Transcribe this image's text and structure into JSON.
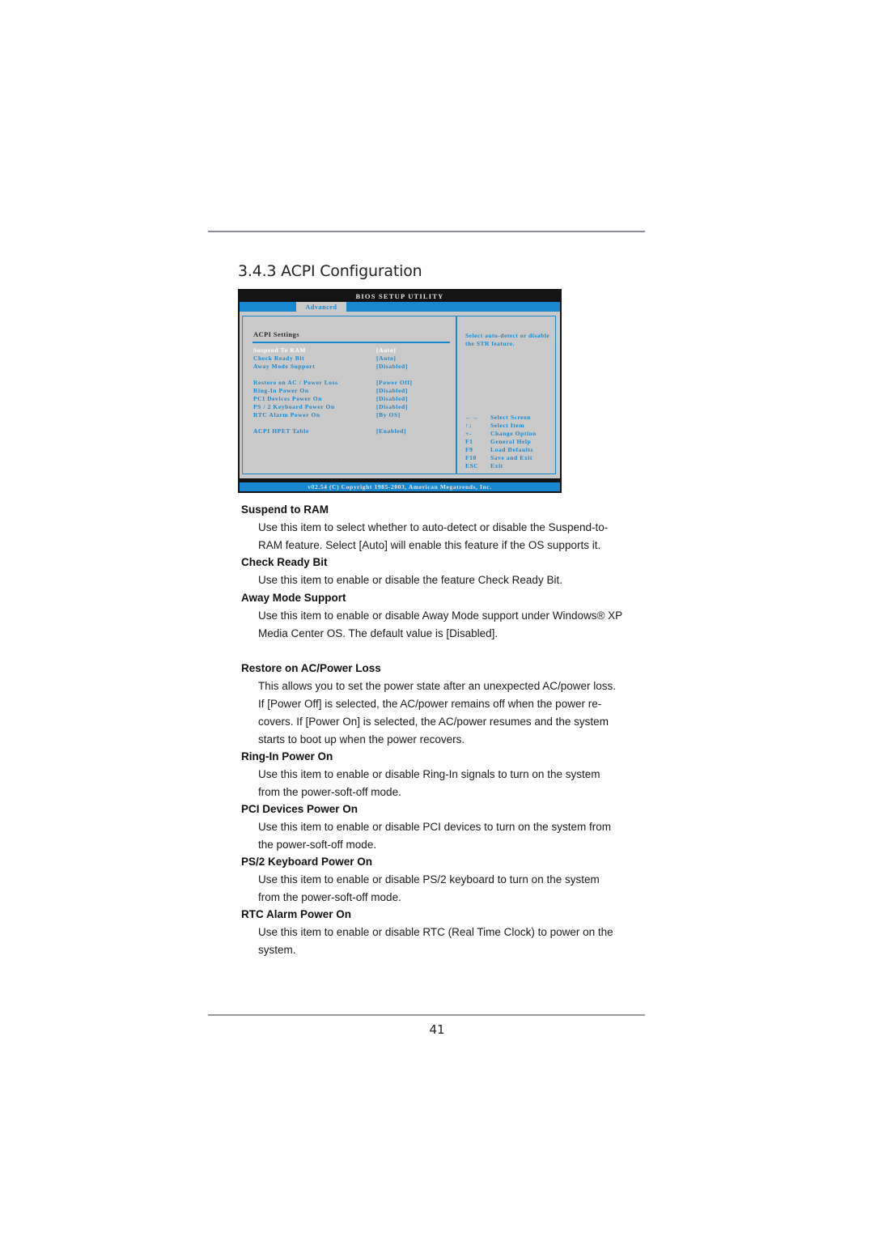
{
  "section": {
    "number": "3.4.3",
    "title": "3.4.3  ACPI Configuration"
  },
  "bios": {
    "title": "BIOS SETUP UTILITY",
    "active_tab": "Advanced",
    "heading": "ACPI Settings",
    "settings": [
      {
        "label": "Suspend To RAM",
        "value": "[Auto]",
        "selected": true
      },
      {
        "label": "Check Ready Bit",
        "value": "[Auto]",
        "selected": false
      },
      {
        "label": "Away Mode Support",
        "value": "[Disabled]",
        "selected": false
      },
      {
        "label": "Restore on AC / Power Loss",
        "value": "[Power Off]",
        "selected": false
      },
      {
        "label": "Ring-In Power On",
        "value": "[Disabled]",
        "selected": false
      },
      {
        "label": "PCI Devices Power On",
        "value": "[Disabled]",
        "selected": false
      },
      {
        "label": "PS / 2 Keyboard Power On",
        "value": "[Disabled]",
        "selected": false
      },
      {
        "label": "RTC Alarm Power On",
        "value": "[By OS]",
        "selected": false
      },
      {
        "label": "ACPI HPET Table",
        "value": "[Enabled]",
        "selected": false
      }
    ],
    "help_text": "Select auto-detect or disable the STR feature.",
    "keys": [
      {
        "key": "←→",
        "action": "Select Screen"
      },
      {
        "key": "↑↓",
        "action": "Select Item"
      },
      {
        "key": "+-",
        "action": "Change Option"
      },
      {
        "key": "F1",
        "action": "General Help"
      },
      {
        "key": "F9",
        "action": "Load Defaults"
      },
      {
        "key": "F10",
        "action": "Save and Exit"
      },
      {
        "key": "ESC",
        "action": "Exit"
      }
    ],
    "footer": "v02.54 (C) Copyright 1985-2003, American Megatrends, Inc.",
    "colors": {
      "accent": "#1787cf",
      "panel": "#c9c9c9",
      "titlebar": "#141414"
    }
  },
  "items": [
    {
      "title": "Suspend to RAM",
      "lines": [
        "Use this item to select whether to auto-detect or disable the Suspend-to-",
        "RAM feature. Select [Auto] will enable this feature if the OS supports it."
      ]
    },
    {
      "title": "Check Ready Bit",
      "lines": [
        "Use this item to enable or disable the feature Check Ready Bit."
      ]
    },
    {
      "title": "Away Mode Support",
      "lines": [
        "Use this item to enable or disable Away Mode support under Windows® XP",
        "Media Center OS. The default value is [Disabled]."
      ]
    },
    {
      "title": "Restore on AC/Power Loss",
      "lines": [
        "This allows you to set the power state after an unexpected AC/power loss.",
        "If [Power Off] is selected, the AC/power remains off when the power re-",
        "covers. If [Power On] is selected, the AC/power resumes and the system",
        "starts to boot up when the power recovers."
      ]
    },
    {
      "title": "Ring-In Power On",
      "lines": [
        "Use this item to enable or disable Ring-In signals to turn on the system",
        "from the power-soft-off mode."
      ]
    },
    {
      "title": "PCI Devices Power On",
      "lines": [
        "Use this item to enable or disable PCI devices to turn on the system from",
        "the power-soft-off mode."
      ]
    },
    {
      "title": "PS/2 Keyboard Power On",
      "lines": [
        "Use this item to enable or disable PS/2 keyboard to turn on the system",
        "from the power-soft-off mode."
      ]
    },
    {
      "title": "RTC Alarm Power On",
      "lines": [
        "Use this item to enable or disable RTC (Real Time Clock) to power on the",
        "system."
      ]
    }
  ],
  "page_number": "41"
}
